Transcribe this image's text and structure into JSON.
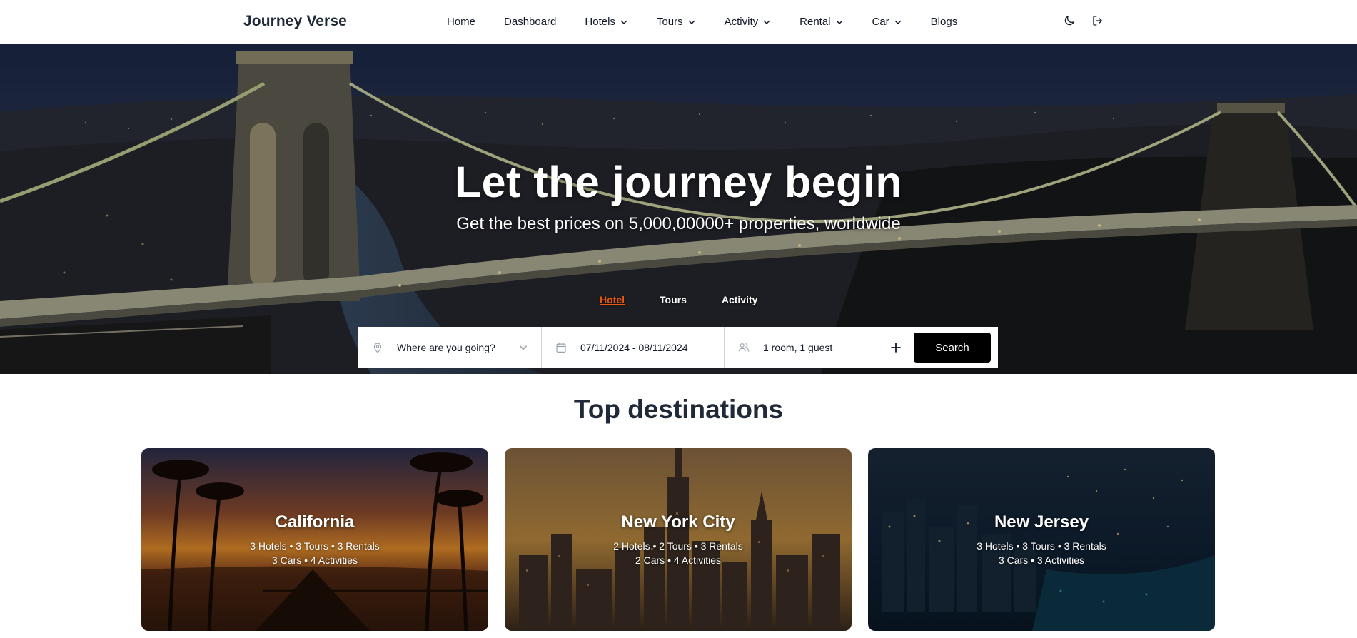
{
  "header": {
    "brand": "Journey Verse",
    "nav": [
      {
        "label": "Home",
        "dropdown": false
      },
      {
        "label": "Dashboard",
        "dropdown": false
      },
      {
        "label": "Hotels",
        "dropdown": true
      },
      {
        "label": "Tours",
        "dropdown": true
      },
      {
        "label": "Activity",
        "dropdown": true
      },
      {
        "label": "Rental",
        "dropdown": true
      },
      {
        "label": "Car",
        "dropdown": true
      },
      {
        "label": "Blogs",
        "dropdown": false
      }
    ],
    "icons": [
      "moon-icon",
      "logout-icon"
    ]
  },
  "hero": {
    "title": "Let the journey begin",
    "subtitle": "Get the best prices on 5,000,00000+ properties, worldwide",
    "tabs": [
      {
        "label": "Hotel",
        "active": true
      },
      {
        "label": "Tours",
        "active": false
      },
      {
        "label": "Activity",
        "active": false
      }
    ],
    "search": {
      "where": "Where are you going?",
      "dates": "07/11/2024 - 08/11/2024",
      "guests": "1 room, 1 guest",
      "button": "Search"
    }
  },
  "destinations": {
    "title": "Top destinations",
    "cards": [
      {
        "name": "California",
        "line1": "3 Hotels • 3 Tours • 3 Rentals",
        "line2": "3 Cars • 4 Activities"
      },
      {
        "name": "New York City",
        "line1": "2 Hotels • 2 Tours • 3 Rentals",
        "line2": "2 Cars • 4 Activities"
      },
      {
        "name": "New Jersey",
        "line1": "3 Hotels • 3 Tours • 3 Rentals",
        "line2": "3 Cars • 3 Activities"
      }
    ]
  },
  "colors": {
    "accent": "#ea580c",
    "search_button": "#000000",
    "text": "#1f2937"
  }
}
